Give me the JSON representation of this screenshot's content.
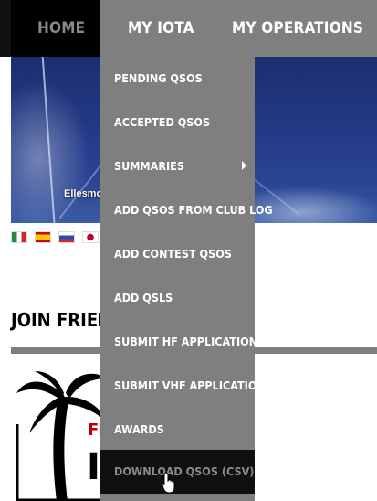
{
  "nav": {
    "home": "HOME",
    "my_iota": "MY IOTA",
    "my_operations": "MY OPERATIONS"
  },
  "hero": {
    "caption": "Ellesmo"
  },
  "flags": [
    "italian-flag-icon",
    "spanish-flag-icon",
    "russian-flag-icon",
    "japanese-flag-icon"
  ],
  "join": {
    "heading": "JOIN FRIEND"
  },
  "logo": {
    "text_red": "FR",
    "text_black": "I"
  },
  "dropdown": {
    "items": [
      {
        "label": "PENDING QSOS"
      },
      {
        "label": "ACCEPTED QSOS"
      },
      {
        "label": "SUMMARIES",
        "has_submenu": true
      },
      {
        "label": "ADD QSOS FROM CLUB LOG"
      },
      {
        "label": "ADD CONTEST QSOS"
      },
      {
        "label": "ADD QSLS"
      },
      {
        "label": "SUBMIT HF APPLICATION"
      },
      {
        "label": "SUBMIT VHF APPLICATION"
      },
      {
        "label": "AWARDS"
      },
      {
        "label": "DOWNLOAD QSOS (CSV)",
        "hovered": true
      }
    ]
  },
  "colors": {
    "nav_dark": "#101010",
    "menu_gray": "#7f7f7f",
    "hover_bg": "#101010",
    "hover_text": "#8a8a8a",
    "logo_red": "#c00000"
  }
}
